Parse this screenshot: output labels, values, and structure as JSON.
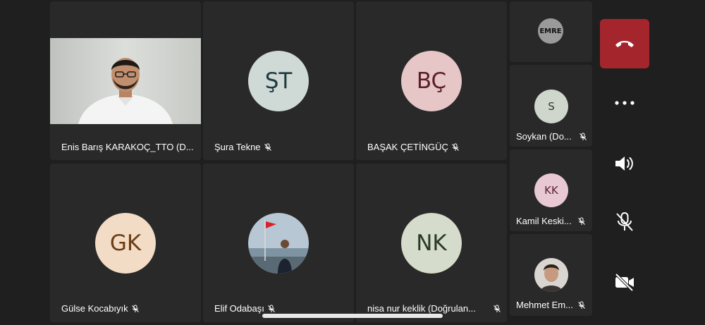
{
  "participants": [
    {
      "name": "Enis Barış KARAKOÇ_TTO (D...",
      "muted": false,
      "has_video": true
    },
    {
      "name": "Şura Tekne",
      "initials": "ŞT",
      "avatar_color": "#cfd9d6",
      "initials_color": "#1f3a3d",
      "muted": true
    },
    {
      "name": "BAŞAK ÇETİNGÜÇ",
      "initials": "BÇ",
      "avatar_color": "#e6c6c6",
      "initials_color": "#5a1f27",
      "muted": true
    },
    {
      "name": "Gülse Kocabıyık",
      "initials": "GK",
      "avatar_color": "#f2dcc5",
      "initials_color": "#6b3d16",
      "muted": true
    },
    {
      "name": "Elif Odabaşı",
      "muted": true,
      "has_photo": true
    },
    {
      "name": "nisa nur keklik (Doğrulan...",
      "initials": "NK",
      "avatar_color": "#d6dccb",
      "initials_color": "#2a3a24",
      "muted": true
    }
  ],
  "side_participants": [
    {
      "name": "",
      "avatar_text": "EMRE",
      "has_logo": true,
      "muted": false
    },
    {
      "name": "Soykan (Do...",
      "initials": "S",
      "avatar_color": "#cfd6cc",
      "initials_color": "#2e3a2c",
      "muted": true
    },
    {
      "name": "Kamil Keski...",
      "initials": "KK",
      "avatar_color": "#e8c9d3",
      "initials_color": "#5a1f35",
      "muted": true
    },
    {
      "name": "Mehmet Em...",
      "muted": true,
      "has_photo": true
    }
  ],
  "controls": {
    "end_call_color": "#a4262c",
    "items": [
      "end-call",
      "more-options",
      "speaker",
      "microphone-off",
      "camera-off"
    ]
  }
}
